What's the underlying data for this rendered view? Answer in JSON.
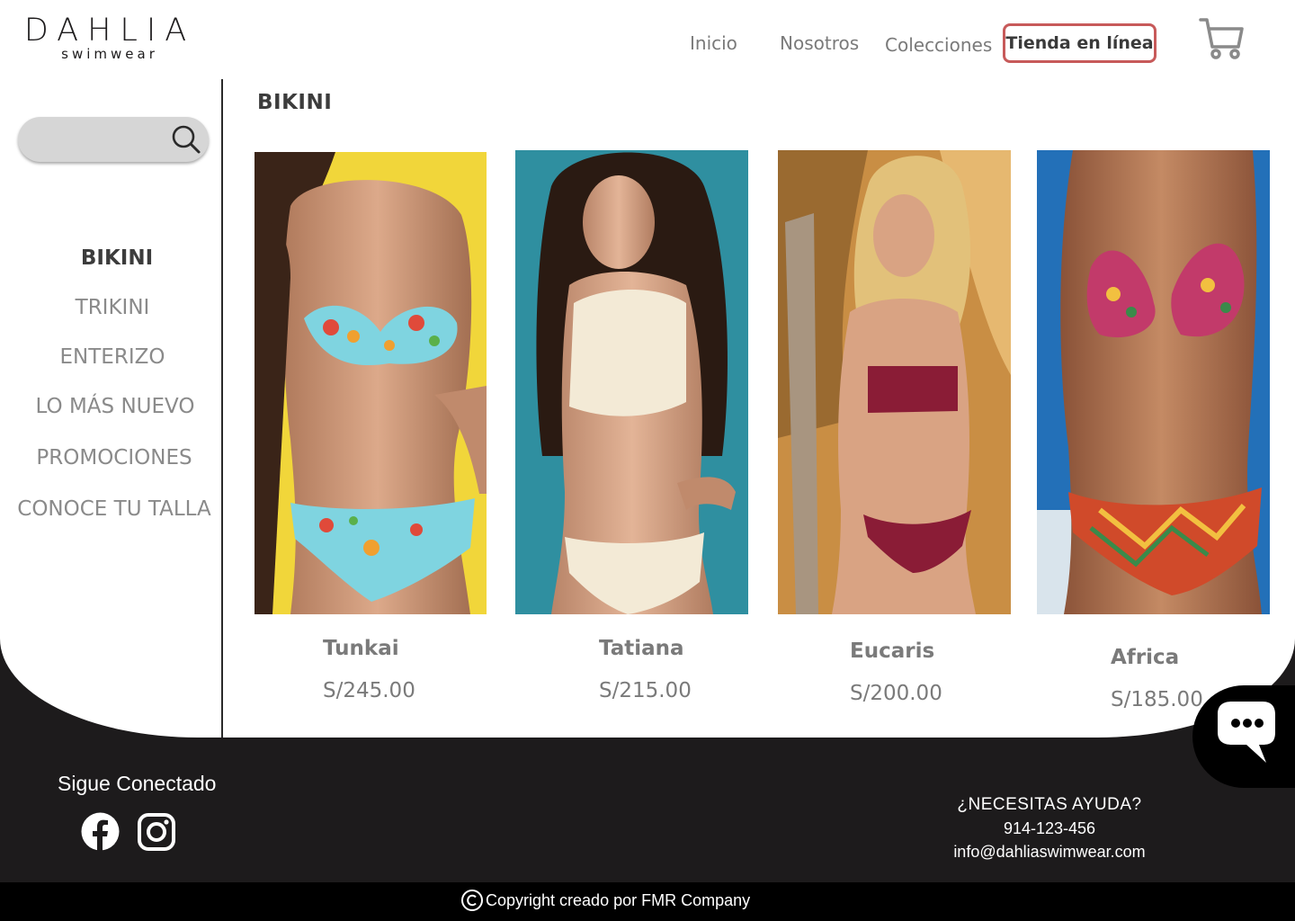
{
  "brand": {
    "name": "DAHLIA",
    "tagline": "swimwear"
  },
  "nav": {
    "items": [
      "Inicio",
      "Nosotros",
      "Colecciones"
    ],
    "active": "Tienda en línea"
  },
  "icons": {
    "cart": "cart-icon",
    "search": "search-icon",
    "chat": "chat-icon",
    "facebook": "facebook-icon",
    "instagram": "instagram-icon",
    "copyright": "copyright-icon"
  },
  "sidebar": {
    "search_placeholder": "",
    "items": [
      {
        "label": "BIKINI"
      },
      {
        "label": "TRIKINI"
      },
      {
        "label": "ENTERIZO"
      },
      {
        "label": "LO MÁS NUEVO"
      },
      {
        "label": "PROMOCIONES"
      },
      {
        "label": "CONOCE TU TALLA"
      }
    ]
  },
  "main": {
    "section_title": "BIKINI",
    "products": [
      {
        "name": "Tunkai",
        "price": "S/245.00"
      },
      {
        "name": "Tatiana",
        "price": "S/215.00"
      },
      {
        "name": "Eucaris",
        "price": "S/200.00"
      },
      {
        "name": "Africa",
        "price": "S/185.00"
      }
    ]
  },
  "footer": {
    "follow_title": "Sigue Conectado",
    "help_title": "¿NECESITAS AYUDA?",
    "phone": "914-123-456",
    "email": "info@dahliaswimwear.com",
    "copyright": "Copyright creado por FMR Company"
  },
  "colors": {
    "accent": "#c75a5a",
    "footer_bg": "#1d1b1c",
    "text_muted": "#7a7a7a"
  }
}
